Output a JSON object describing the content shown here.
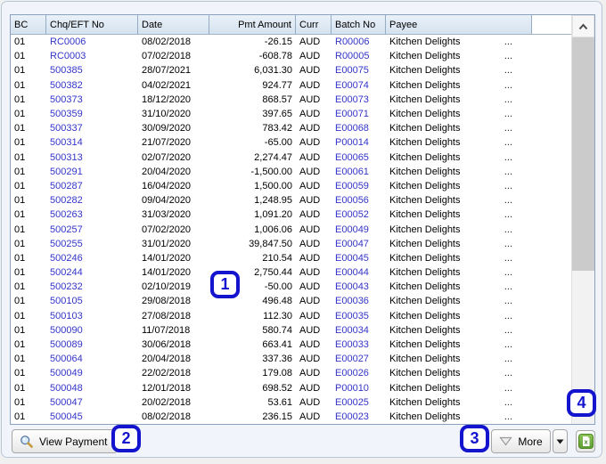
{
  "table": {
    "columns": [
      {
        "key": "bc",
        "label": "BC"
      },
      {
        "key": "chq",
        "label": "Chq/EFT No"
      },
      {
        "key": "date",
        "label": "Date"
      },
      {
        "key": "amount",
        "label": "Pmt Amount"
      },
      {
        "key": "curr",
        "label": "Curr"
      },
      {
        "key": "batch",
        "label": "Batch No"
      },
      {
        "key": "payee",
        "label": "Payee"
      }
    ],
    "rows": [
      {
        "bc": "01",
        "chq": "RC0006",
        "date": "08/02/2018",
        "amount": "-26.15",
        "curr": "AUD",
        "batch": "R00006",
        "payee": "Kitchen Delights",
        "more": "..."
      },
      {
        "bc": "01",
        "chq": "RC0003",
        "date": "07/02/2018",
        "amount": "-608.78",
        "curr": "AUD",
        "batch": "R00005",
        "payee": "Kitchen Delights",
        "more": "..."
      },
      {
        "bc": "01",
        "chq": "500385",
        "date": "28/07/2021",
        "amount": "6,031.30",
        "curr": "AUD",
        "batch": "E00075",
        "payee": "Kitchen Delights",
        "more": "..."
      },
      {
        "bc": "01",
        "chq": "500382",
        "date": "04/02/2021",
        "amount": "924.77",
        "curr": "AUD",
        "batch": "E00074",
        "payee": "Kitchen Delights",
        "more": "..."
      },
      {
        "bc": "01",
        "chq": "500373",
        "date": "18/12/2020",
        "amount": "868.57",
        "curr": "AUD",
        "batch": "E00073",
        "payee": "Kitchen Delights",
        "more": "..."
      },
      {
        "bc": "01",
        "chq": "500359",
        "date": "31/10/2020",
        "amount": "397.65",
        "curr": "AUD",
        "batch": "E00071",
        "payee": "Kitchen Delights",
        "more": "..."
      },
      {
        "bc": "01",
        "chq": "500337",
        "date": "30/09/2020",
        "amount": "783.42",
        "curr": "AUD",
        "batch": "E00068",
        "payee": "Kitchen Delights",
        "more": "..."
      },
      {
        "bc": "01",
        "chq": "500314",
        "date": "21/07/2020",
        "amount": "-65.00",
        "curr": "AUD",
        "batch": "P00014",
        "payee": "Kitchen Delights",
        "more": "..."
      },
      {
        "bc": "01",
        "chq": "500313",
        "date": "02/07/2020",
        "amount": "2,274.47",
        "curr": "AUD",
        "batch": "E00065",
        "payee": "Kitchen Delights",
        "more": "..."
      },
      {
        "bc": "01",
        "chq": "500291",
        "date": "20/04/2020",
        "amount": "-1,500.00",
        "curr": "AUD",
        "batch": "E00061",
        "payee": "Kitchen Delights",
        "more": "..."
      },
      {
        "bc": "01",
        "chq": "500287",
        "date": "16/04/2020",
        "amount": "1,500.00",
        "curr": "AUD",
        "batch": "E00059",
        "payee": "Kitchen Delights",
        "more": "..."
      },
      {
        "bc": "01",
        "chq": "500282",
        "date": "09/04/2020",
        "amount": "1,248.95",
        "curr": "AUD",
        "batch": "E00056",
        "payee": "Kitchen Delights",
        "more": "..."
      },
      {
        "bc": "01",
        "chq": "500263",
        "date": "31/03/2020",
        "amount": "1,091.20",
        "curr": "AUD",
        "batch": "E00052",
        "payee": "Kitchen Delights",
        "more": "..."
      },
      {
        "bc": "01",
        "chq": "500257",
        "date": "07/02/2020",
        "amount": "1,006.06",
        "curr": "AUD",
        "batch": "E00049",
        "payee": "Kitchen Delights",
        "more": "..."
      },
      {
        "bc": "01",
        "chq": "500255",
        "date": "31/01/2020",
        "amount": "39,847.50",
        "curr": "AUD",
        "batch": "E00047",
        "payee": "Kitchen Delights",
        "more": "..."
      },
      {
        "bc": "01",
        "chq": "500246",
        "date": "14/01/2020",
        "amount": "210.54",
        "curr": "AUD",
        "batch": "E00045",
        "payee": "Kitchen Delights",
        "more": "..."
      },
      {
        "bc": "01",
        "chq": "500244",
        "date": "14/01/2020",
        "amount": "2,750.44",
        "curr": "AUD",
        "batch": "E00044",
        "payee": "Kitchen Delights",
        "more": "..."
      },
      {
        "bc": "01",
        "chq": "500232",
        "date": "02/10/2019",
        "amount": "-50.00",
        "curr": "AUD",
        "batch": "E00043",
        "payee": "Kitchen Delights",
        "more": "..."
      },
      {
        "bc": "01",
        "chq": "500105",
        "date": "29/08/2018",
        "amount": "496.48",
        "curr": "AUD",
        "batch": "E00036",
        "payee": "Kitchen Delights",
        "more": "..."
      },
      {
        "bc": "01",
        "chq": "500103",
        "date": "27/08/2018",
        "amount": "112.30",
        "curr": "AUD",
        "batch": "E00035",
        "payee": "Kitchen Delights",
        "more": "..."
      },
      {
        "bc": "01",
        "chq": "500090",
        "date": "11/07/2018",
        "amount": "580.74",
        "curr": "AUD",
        "batch": "E00034",
        "payee": "Kitchen Delights",
        "more": "..."
      },
      {
        "bc": "01",
        "chq": "500089",
        "date": "30/06/2018",
        "amount": "663.41",
        "curr": "AUD",
        "batch": "E00033",
        "payee": "Kitchen Delights",
        "more": "..."
      },
      {
        "bc": "01",
        "chq": "500064",
        "date": "20/04/2018",
        "amount": "337.36",
        "curr": "AUD",
        "batch": "E00027",
        "payee": "Kitchen Delights",
        "more": "..."
      },
      {
        "bc": "01",
        "chq": "500049",
        "date": "22/02/2018",
        "amount": "179.08",
        "curr": "AUD",
        "batch": "E00026",
        "payee": "Kitchen Delights",
        "more": "..."
      },
      {
        "bc": "01",
        "chq": "500048",
        "date": "12/01/2018",
        "amount": "698.52",
        "curr": "AUD",
        "batch": "P00010",
        "payee": "Kitchen Delights",
        "more": "..."
      },
      {
        "bc": "01",
        "chq": "500047",
        "date": "20/02/2018",
        "amount": "53.61",
        "curr": "AUD",
        "batch": "E00025",
        "payee": "Kitchen Delights",
        "more": "..."
      },
      {
        "bc": "01",
        "chq": "500045",
        "date": "08/02/2018",
        "amount": "236.15",
        "curr": "AUD",
        "batch": "E00023",
        "payee": "Kitchen Delights",
        "more": "..."
      }
    ]
  },
  "toolbar": {
    "view_payment_label": "View Payment",
    "more_label": "More"
  },
  "icons": {
    "view_payment": "magnifier-icon",
    "more": "filter-triangle-icon",
    "dropdown": "caret-down-icon",
    "export": "excel-export-icon",
    "scroll_up": "chevron-up-icon"
  },
  "annotations": {
    "badge1": "1",
    "badge2": "2",
    "badge3": "3",
    "badge4": "4"
  },
  "colors": {
    "link": "#3434c9",
    "header_bg": "#dbe6f1",
    "table_border": "#8aa2bd",
    "annotation_blue": "#1414cf",
    "excel_green": "#6fb044"
  }
}
